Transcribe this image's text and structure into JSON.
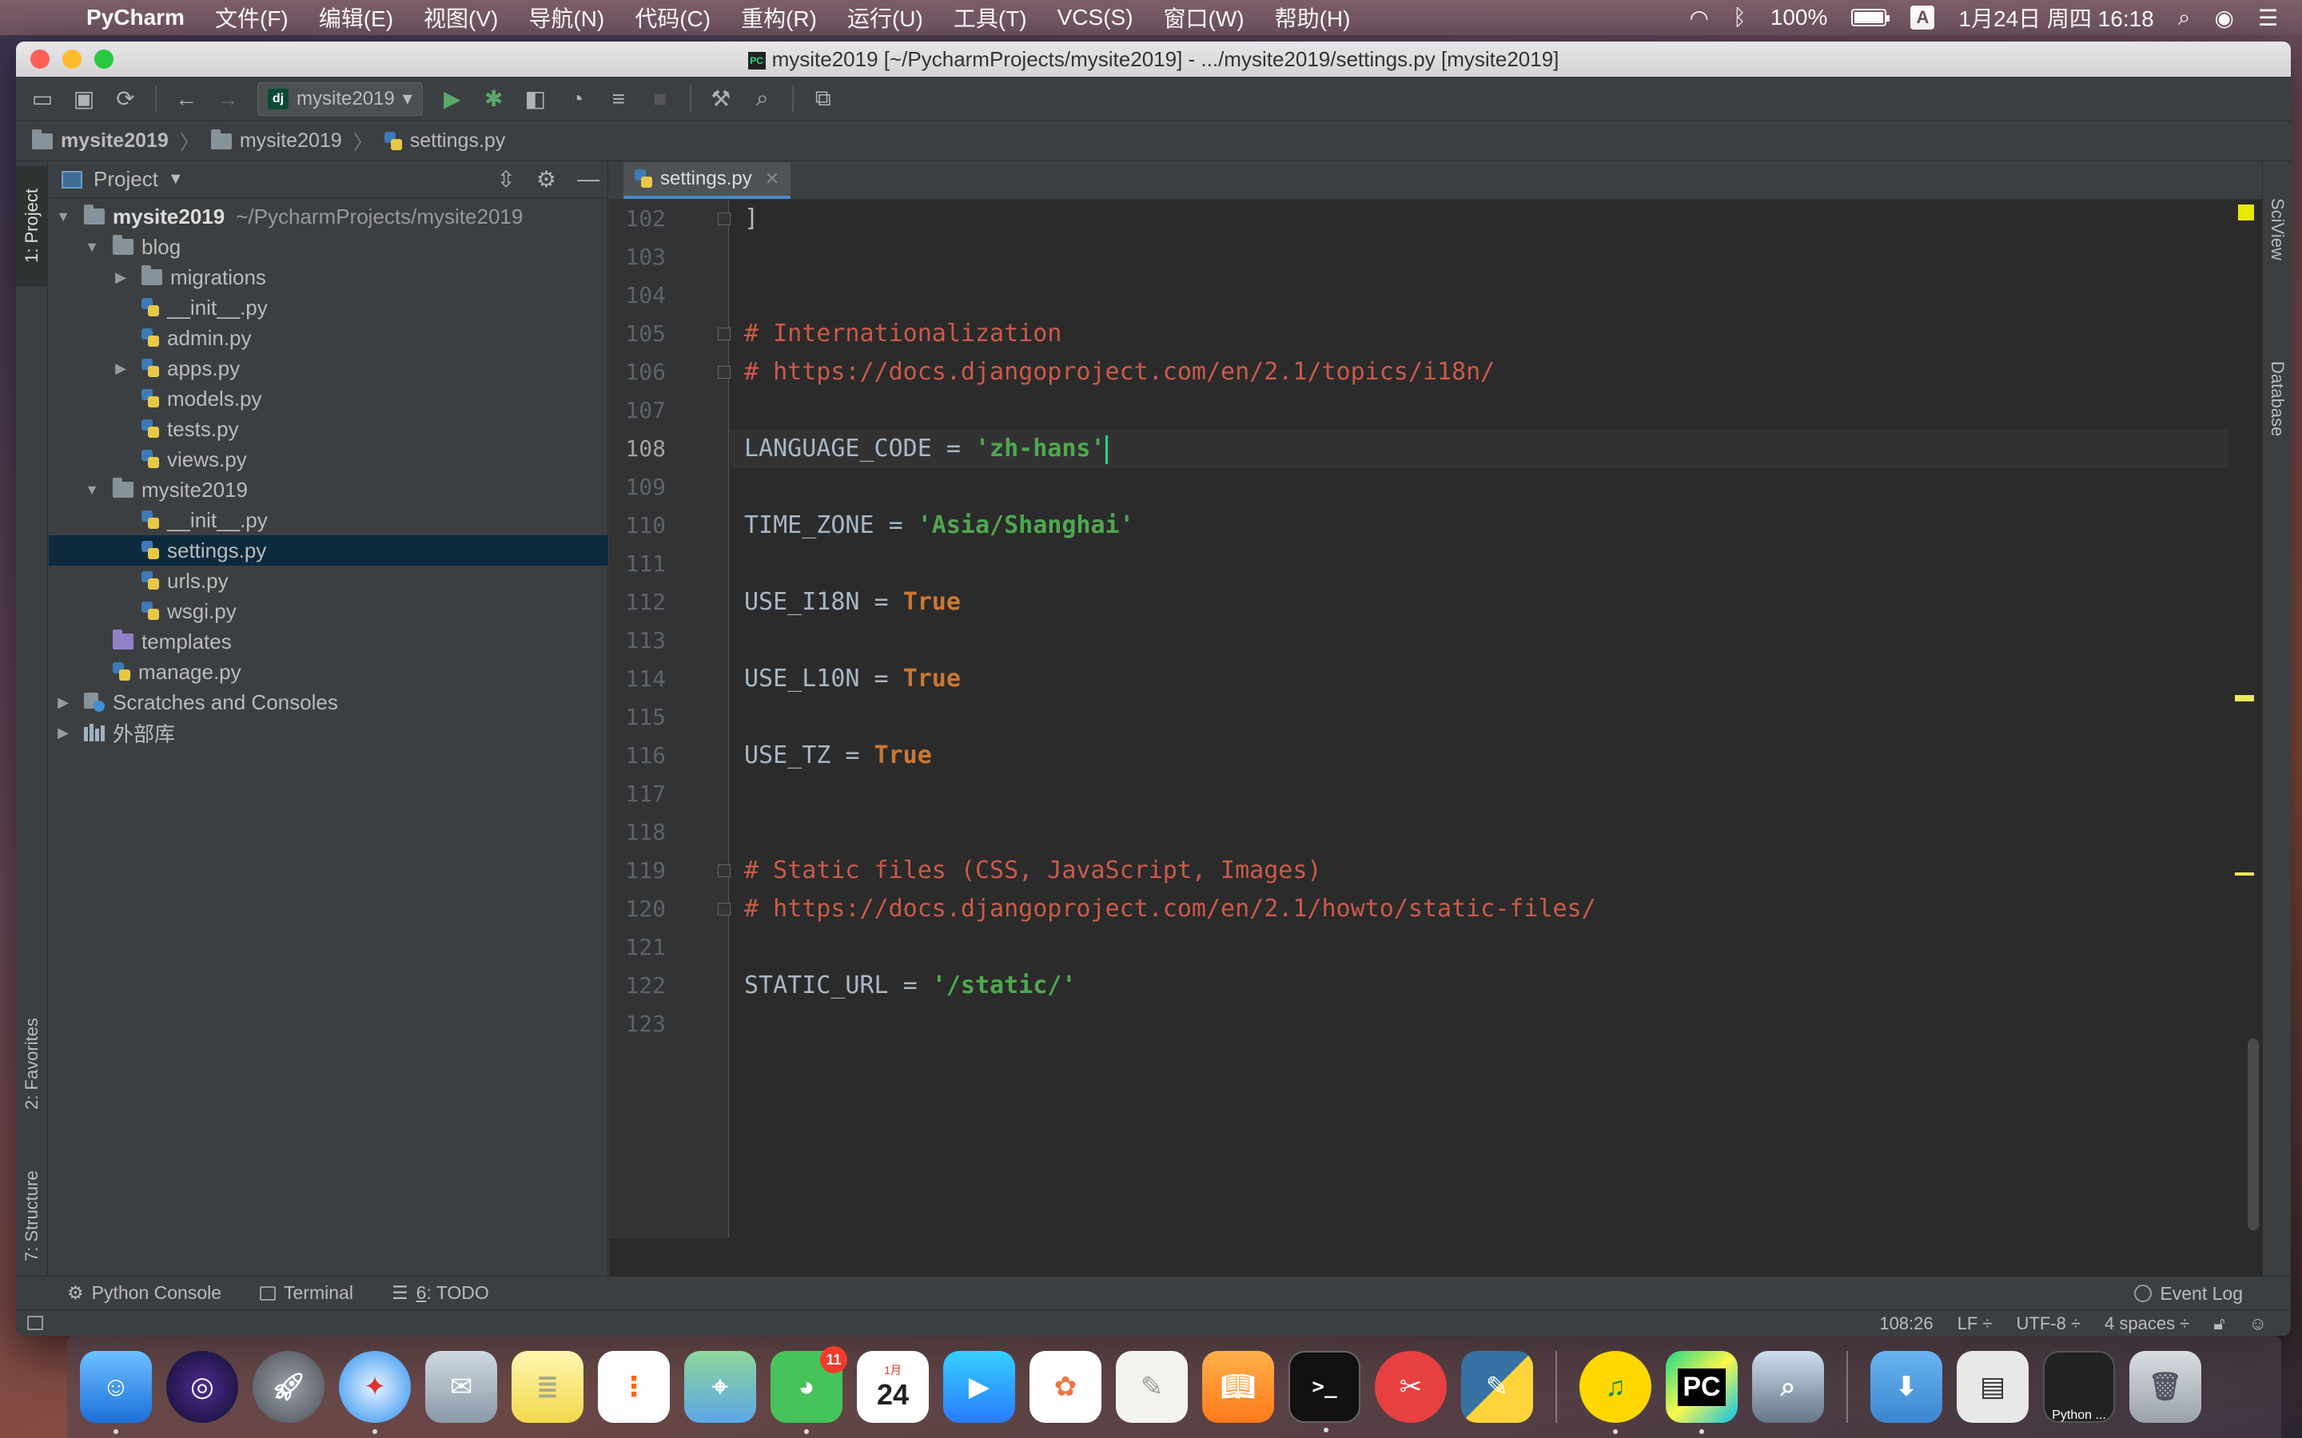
{
  "menubar": {
    "apple_glyph": "",
    "app_name": "PyCharm",
    "menus": [
      "文件(F)",
      "编辑(E)",
      "视图(V)",
      "导航(N)",
      "代码(C)",
      "重构(R)",
      "运行(U)",
      "工具(T)",
      "VCS(S)",
      "窗口(W)",
      "帮助(H)"
    ],
    "battery_percent": "100%",
    "battery_level": 1.0,
    "ime": "A",
    "clock": "1月24日 周四  16:18"
  },
  "window": {
    "title": "mysite2019 [~/PycharmProjects/mysite2019] - .../mysite2019/settings.py [mysite2019]",
    "title_icon_text": "PC"
  },
  "toolbar": {
    "run_config_badge": "dj",
    "run_config": "mysite2019"
  },
  "breadcrumb": {
    "items": [
      "mysite2019",
      "mysite2019",
      "settings.py"
    ]
  },
  "left_stripe": {
    "project": "1: Project",
    "favorites": "2: Favorites",
    "structure": "7: Structure"
  },
  "project": {
    "header": "Project",
    "tree": [
      {
        "label": "mysite2019",
        "path": "~/PycharmProjects/mysite2019"
      },
      {
        "label": "blog"
      },
      {
        "label": "migrations"
      },
      {
        "label": "__init__.py"
      },
      {
        "label": "admin.py"
      },
      {
        "label": "apps.py"
      },
      {
        "label": "models.py"
      },
      {
        "label": "tests.py"
      },
      {
        "label": "views.py"
      },
      {
        "label": "mysite2019"
      },
      {
        "label": "__init__.py"
      },
      {
        "label": "settings.py"
      },
      {
        "label": "urls.py"
      },
      {
        "label": "wsgi.py"
      },
      {
        "label": "templates"
      },
      {
        "label": "manage.py"
      },
      {
        "label": "Scratches and Consoles"
      },
      {
        "label": "外部库"
      }
    ]
  },
  "editor": {
    "tab": "settings.py",
    "lines": [
      "102",
      "103",
      "104",
      "105",
      "106",
      "107",
      "108",
      "109",
      "110",
      "111",
      "112",
      "113",
      "114",
      "115",
      "116",
      "117",
      "118",
      "119",
      "120",
      "121",
      "122",
      "123"
    ],
    "code": {
      "l102": "]",
      "l105": "# Internationalization",
      "l106": "# https://docs.djangoproject.com/en/2.1/topics/i18n/",
      "l108_name": "LANGUAGE_CODE",
      "l108_eq": " = ",
      "l108_val": "'zh-hans'",
      "l110_name": "TIME_ZONE",
      "l110_eq": " = ",
      "l110_val": "'Asia/Shanghai'",
      "l112_name": "USE_I18N",
      "l112_eq": " = ",
      "l112_val": "True",
      "l114_name": "USE_L10N",
      "l114_eq": " = ",
      "l114_val": "True",
      "l116_name": "USE_TZ",
      "l116_eq": " = ",
      "l116_val": "True",
      "l119": "# Static files (CSS, JavaScript, Images)",
      "l120": "# https://docs.djangoproject.com/en/2.1/howto/static-files/",
      "l122_name": "STATIC_URL",
      "l122_eq": " = ",
      "l122_val": "'/static/'"
    }
  },
  "right_stripe": {
    "sciview": "SciView",
    "database": "Database"
  },
  "bottom_tools": {
    "python_console": "Python Console",
    "terminal": "Terminal",
    "todo_num": "6",
    "todo": ": TODO",
    "event_log": "Event Log"
  },
  "statusbar": {
    "position": "108:26",
    "line_sep": "LF ÷",
    "encoding": "UTF-8 ÷",
    "indent": "4 spaces ÷"
  },
  "dock": {
    "wechat_badge": "11",
    "calendar_month": "1月",
    "calendar_day": "24",
    "terminal_prompt": ">_",
    "pycharm": "PC",
    "python_caption": "Python ..."
  },
  "colors": {
    "editor_bg": "#2b2b2b",
    "comment": "#cc5a4a",
    "string": "#4fa84f",
    "keyword": "#cc7832",
    "selection": "#0d293e"
  }
}
